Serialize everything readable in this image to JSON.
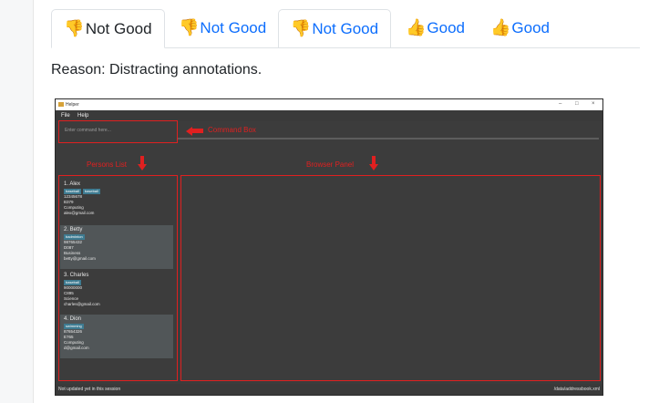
{
  "tabs": [
    {
      "label": "Not Good",
      "icon": "thumbs-down-icon",
      "active": true
    },
    {
      "label": "Not Good",
      "icon": "thumbs-down-icon",
      "active": false
    },
    {
      "label": "Not Good",
      "icon": "thumbs-down-icon",
      "active": false
    },
    {
      "label": "Good",
      "icon": "thumbs-up-icon",
      "active": false
    },
    {
      "label": "Good",
      "icon": "thumbs-up-icon",
      "active": false
    }
  ],
  "reason": "Reason: Distracting annotations.",
  "app": {
    "window_title": "Helper",
    "window_controls": [
      "–",
      "□",
      "×"
    ],
    "menu": [
      "File",
      "Help"
    ],
    "command_placeholder": "Enter command here...",
    "persons": [
      {
        "name": "1.  Alex",
        "tags": [
          "baseball",
          "baseball"
        ],
        "phone": "12345678",
        "room": "B379",
        "course": "Computing",
        "email": "alex@gmail.com"
      },
      {
        "name": "2.  Betty",
        "tags": [
          "badminton"
        ],
        "phone": "98765432",
        "room": "D087",
        "course": "Business",
        "email": "betty@gmail.com"
      },
      {
        "name": "3.  Charles",
        "tags": [
          "baseball"
        ],
        "phone": "90000000",
        "room": "C895",
        "course": "Science",
        "email": "charles@gmail.com"
      },
      {
        "name": "4.  Dion",
        "tags": [
          "swimming"
        ],
        "phone": "87654326",
        "room": "E765",
        "course": "Computing",
        "email": "d@gmail.com"
      }
    ],
    "status_left": "Not updated yet in this session",
    "status_right": "/data/addressbook.xml"
  },
  "annotations": {
    "command_box": "Command Box",
    "persons_list": "Persons List",
    "browser_panel": "Browser Panel"
  },
  "colors": {
    "annotation": "#e02020",
    "tab_link": "#0d6efd",
    "app_background": "#3c3c3c",
    "tag_background": "#3e7b91"
  }
}
